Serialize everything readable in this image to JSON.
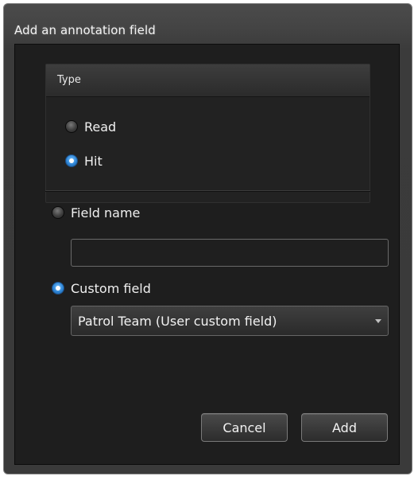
{
  "window": {
    "title": "Add an annotation field"
  },
  "type_group": {
    "header": "Type",
    "options": [
      {
        "label": "Read",
        "checked": false
      },
      {
        "label": "Hit",
        "checked": true
      }
    ]
  },
  "field_name": {
    "label": "Field name",
    "checked": false,
    "value": ""
  },
  "custom_field": {
    "label": "Custom field",
    "checked": true,
    "selected": "Patrol Team (User custom field)"
  },
  "buttons": {
    "cancel": "Cancel",
    "add": "Add"
  },
  "icons": {
    "dropdown": "chevron-down-icon"
  },
  "colors": {
    "accent": "#2f86d6",
    "background": "#1e1e1e",
    "titlebar": "#444444"
  }
}
